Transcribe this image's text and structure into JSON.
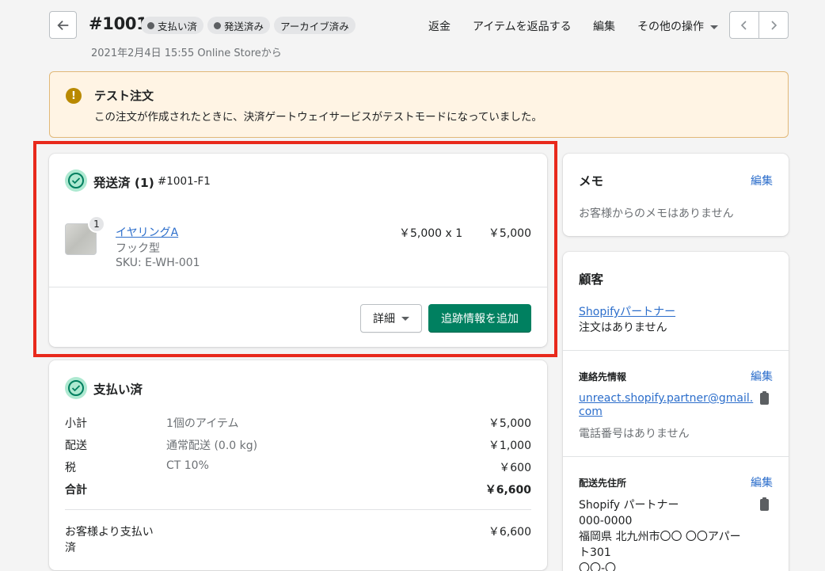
{
  "header": {
    "order_number": "#1001",
    "badges": [
      {
        "label": "支払い済",
        "dot": true
      },
      {
        "label": "発送済み",
        "dot": true
      },
      {
        "label": "アーカイブ済み",
        "dot": false
      }
    ],
    "subtitle": "2021年2月4日 15:55 Online Storeから",
    "actions": {
      "refund": "返金",
      "return": "アイテムを返品する",
      "edit": "編集",
      "more": "その他の操作"
    }
  },
  "banner": {
    "title": "テスト注文",
    "text": "この注文が作成されたときに、決済ゲートウェイサービスがテストモードになっていました。",
    "icon": "alert-circle-icon",
    "color": "#fff4e4"
  },
  "fulfillment": {
    "title": "発送済 (1)",
    "id": "#1001-F1",
    "item": {
      "quantity": "1",
      "name": "イヤリングA",
      "variant": "フック型",
      "sku": "SKU: E-WH-001",
      "unit_price": "￥5,000 x 1",
      "total": "￥5,000"
    },
    "details_button": "詳細",
    "tracking_button": "追跡情報を追加"
  },
  "payment": {
    "title": "支払い済",
    "rows": [
      {
        "label": "小計",
        "desc": "1個のアイテム",
        "amount": "￥5,000"
      },
      {
        "label": "配送",
        "desc": "通常配送 (0.0 kg)",
        "amount": "￥1,000"
      },
      {
        "label": "税",
        "desc": "CT 10%",
        "amount": "￥600"
      }
    ],
    "total_label": "合計",
    "total_amount": "￥6,600",
    "paid_label_1": "お客様より支払い",
    "paid_label_2": "済",
    "paid_amount": "￥6,600"
  },
  "memo": {
    "title": "メモ",
    "edit": "編集",
    "text": "お客様からのメモはありません"
  },
  "customer": {
    "title": "顧客",
    "name": "Shopifyパートナー",
    "orders": "注文はありません",
    "contact_title": "連絡先情報",
    "contact_edit": "編集",
    "email_1": "unreact.shopify.partner@gmail.",
    "email_2": "com",
    "phone": "電話番号はありません",
    "address_title": "配送先住所",
    "address_edit": "編集",
    "address_lines": [
      "Shopify パートナー",
      "000-0000",
      "福岡県 北九州市〇〇 〇〇アパー",
      "ト301",
      "〇〇-〇"
    ]
  },
  "colors": {
    "accent": "#008060",
    "link": "#2c6ecb",
    "highlight": "#e8291c"
  }
}
